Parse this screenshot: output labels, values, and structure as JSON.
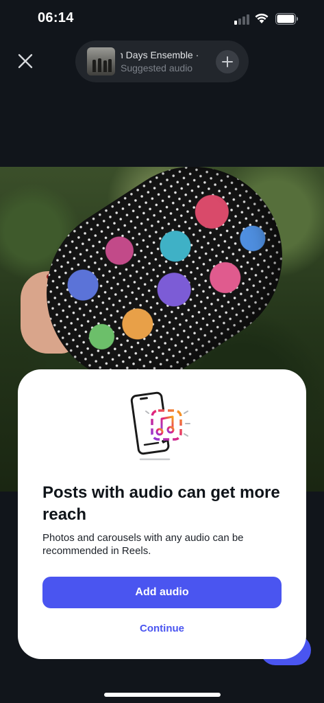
{
  "status_bar": {
    "time": "06:14",
    "signal_bars_active": 1,
    "signal_bars_total": 4
  },
  "top_bar": {
    "close_icon": "close-icon",
    "audio": {
      "title": "n Days Ensemble ·",
      "subtitle": "Suggested audio",
      "add_icon": "plus-icon"
    }
  },
  "photo": {
    "subject_icon": "painted-rock-photo"
  },
  "sheet": {
    "illustration_icon": "phone-music-icon",
    "title": "Posts with audio can get more reach",
    "body": "Photos and carousels with any audio can be recommended in Reels.",
    "primary_label": "Add audio",
    "secondary_label": "Continue"
  },
  "colors": {
    "accent": "#4a55f0",
    "background": "#11151b",
    "sheet": "#ffffff"
  }
}
